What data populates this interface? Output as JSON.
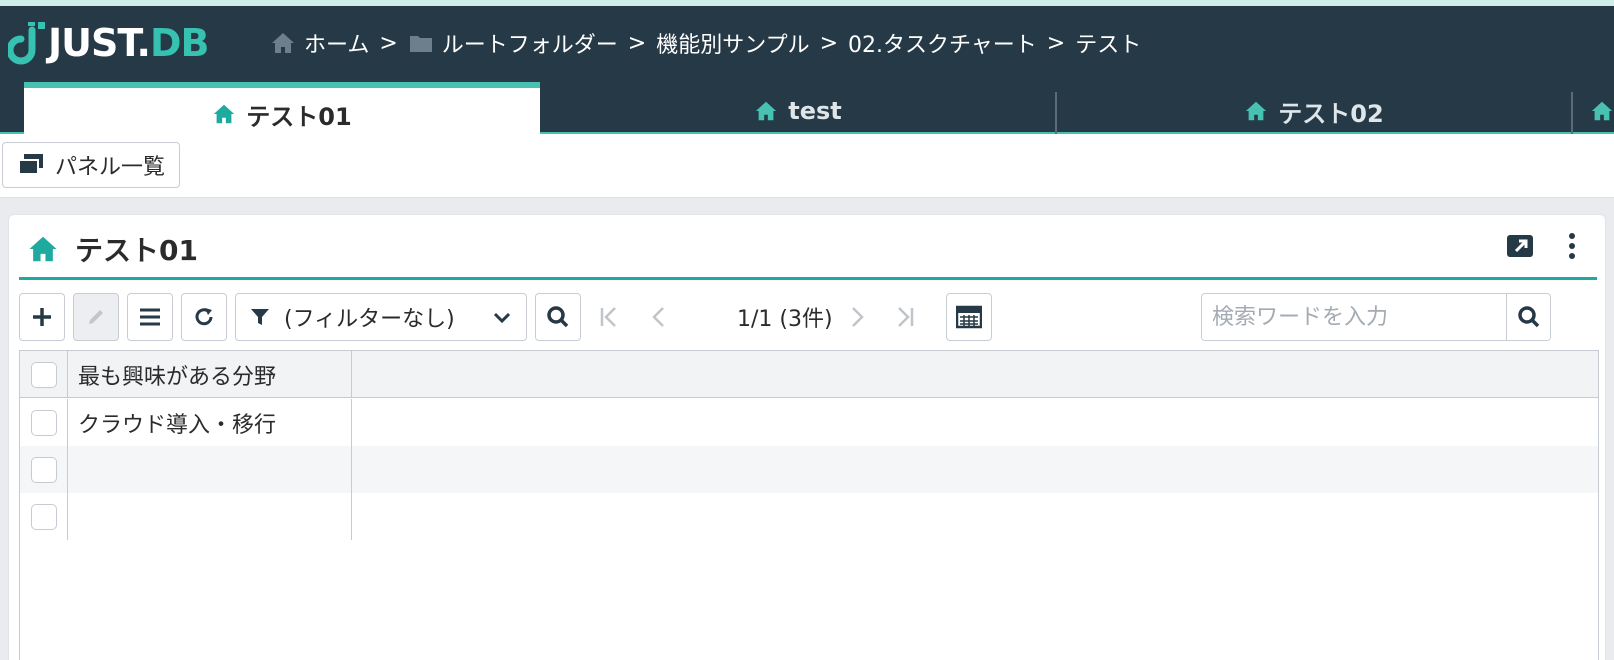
{
  "app": {
    "logo_word": "JUST",
    "logo_dot": ".",
    "logo_db": "DB"
  },
  "breadcrumb": [
    {
      "label": "ホーム",
      "icon": "home-icon"
    },
    {
      "label": "ルートフォルダー",
      "icon": "folder-icon"
    },
    {
      "label": "機能別サンプル"
    },
    {
      "label": "02.タスクチャート"
    },
    {
      "label": "テスト"
    }
  ],
  "breadcrumb_sep": ">",
  "tabs": [
    {
      "label": "テスト01",
      "active": true
    },
    {
      "label": "test",
      "active": false
    },
    {
      "label": "テスト02",
      "active": false
    }
  ],
  "subbar": {
    "panel_list_label": "パネル一覧"
  },
  "panel": {
    "title": "テスト01"
  },
  "toolbar": {
    "filter_label": "(フィルターなし)",
    "pager_text": "1/1 (3件)",
    "search_placeholder": "検索ワードを入力"
  },
  "table": {
    "columns": [
      "最も興味がある分野"
    ],
    "rows": [
      [
        "クラウド導入・移行"
      ],
      [
        ""
      ],
      [
        ""
      ]
    ]
  },
  "colors": {
    "header_bg": "#263947",
    "accent": "#48c1b3",
    "accent_dark": "#1eaa9e"
  }
}
